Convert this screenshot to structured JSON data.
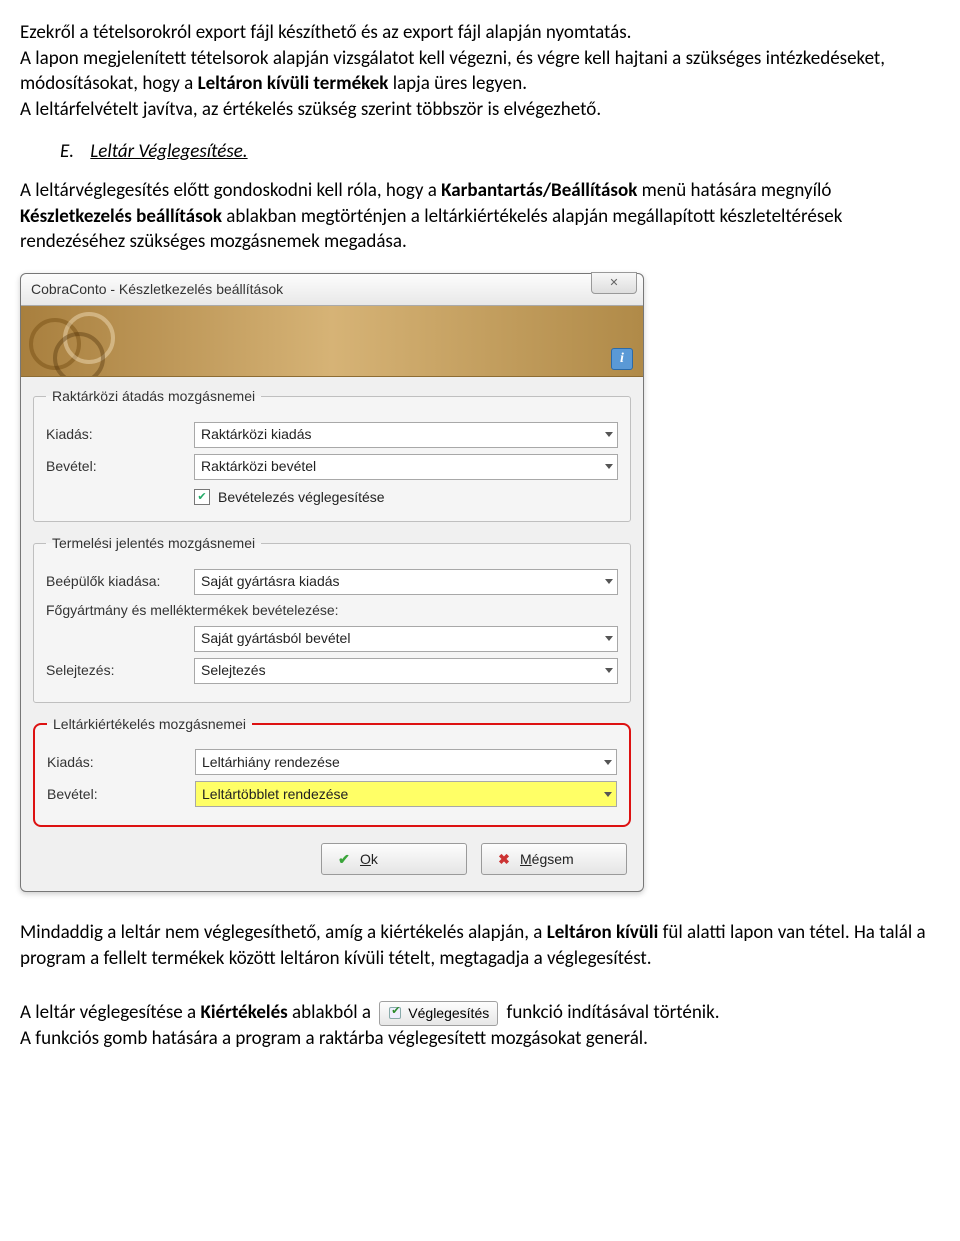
{
  "para1": {
    "t1": "Ezekről a tételsorokról export fájl készíthető és az export fájl alapján nyomtatás.",
    "t2a": "A lapon megjelenített tételsorok alapján vizsgálatot kell végezni, és végre kell hajtani a szükséges intézkedéseket, módosításokat, hogy a ",
    "t2b": "Leltáron kívüli termékek",
    "t2c": " lapja üres legyen.",
    "t3": "A leltárfelvételt javítva, az értékelés szükség szerint többször is elvégezhető."
  },
  "section": {
    "letter": "E.",
    "title": "Leltár Véglegesítése."
  },
  "para2": {
    "a": "A leltárvéglegesítés előtt gondoskodni kell róla, hogy a ",
    "b": "Karbantartás/Beállítások",
    "c": " menü hatására megnyíló ",
    "d": "Készletkezelés beállítások",
    "e": " ablakban megtörténjen a leltárkiértékelés alapján megállapított készleteltérések rendezéséhez szükséges mozgásnemek megadása."
  },
  "window": {
    "title": "CobraConto - Készletkezelés beállítások",
    "close": "✕",
    "info": "i",
    "group1": {
      "legend": "Raktárközi átadás mozgásnemei",
      "kiadas_label": "Kiadás:",
      "kiadas_value": "Raktárközi kiadás",
      "bevetel_label": "Bevétel:",
      "bevetel_value": "Raktárközi bevétel",
      "checkbox_label": "Bevételezés véglegesítése",
      "checkbox_checked": "✔"
    },
    "group2": {
      "legend": "Termelési jelentés mozgásnemei",
      "beepulok_label": "Beépülők kiadása:",
      "beepulok_value": "Saját gyártásra kiadás",
      "fogy_label": "Főgyártmány és melléktermékek bevételezése:",
      "fogy_value": "Saját gyártásból bevétel",
      "selejt_label": "Selejtezés:",
      "selejt_value": "Selejtezés"
    },
    "group3": {
      "legend": "Leltárkiértékelés mozgásnemei",
      "kiadas_label": "Kiadás:",
      "kiadas_value": "Leltárhiány rendezése",
      "bevetel_label": "Bevétel:",
      "bevetel_value": "Leltártöbblet rendezése"
    },
    "buttons": {
      "ok_u": "O",
      "ok_rest": "k",
      "cancel_u": "M",
      "cancel_rest": "égsem"
    }
  },
  "para3": {
    "a": "Mindaddig a leltár nem véglegesíthető, amíg a kiértékelés alapján, a ",
    "b": "Leltáron kívüli",
    "c": " fül alatti lapon van tétel. Ha talál a program a fellelt termékek között leltáron kívüli tételt, megtagadja a véglegesítést."
  },
  "para4": {
    "a": "A leltár véglegesítése a ",
    "b": "Kiértékelés",
    "c": " ablakból a ",
    "btn": "Véglegesítés",
    "d": " funkció indításával történik.",
    "e": "A funkciós gomb hatására a program a raktárba véglegesített mozgásokat generál."
  }
}
